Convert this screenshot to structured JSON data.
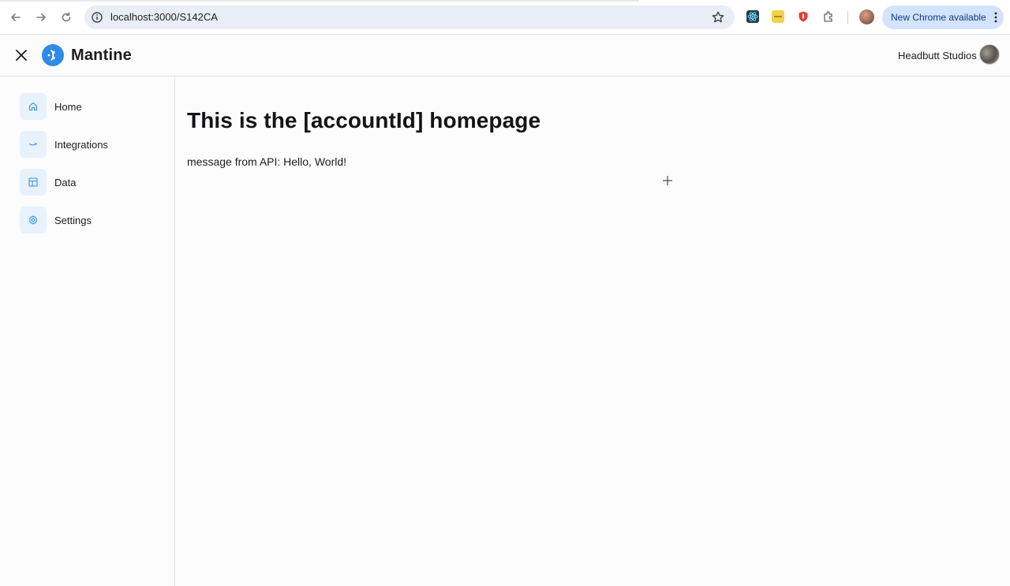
{
  "browser": {
    "url": "localhost:3000/S142CA",
    "update_label": "New Chrome available",
    "accent": "#d3e3fd"
  },
  "header": {
    "brand": "Mantine",
    "org_name": "Headbutt Studios",
    "brand_color": "#2f8ae8"
  },
  "sidebar": {
    "items": [
      {
        "label": "Home",
        "icon": "home-icon"
      },
      {
        "label": "Integrations",
        "icon": "integrations-icon"
      },
      {
        "label": "Data",
        "icon": "layout-icon"
      },
      {
        "label": "Settings",
        "icon": "gear-icon"
      }
    ],
    "icon_bg": "#e7f2fd",
    "icon_color": "#3b8fe4"
  },
  "main": {
    "title": "This is the [accountId] homepage",
    "message": "message from API: Hello, World!"
  }
}
